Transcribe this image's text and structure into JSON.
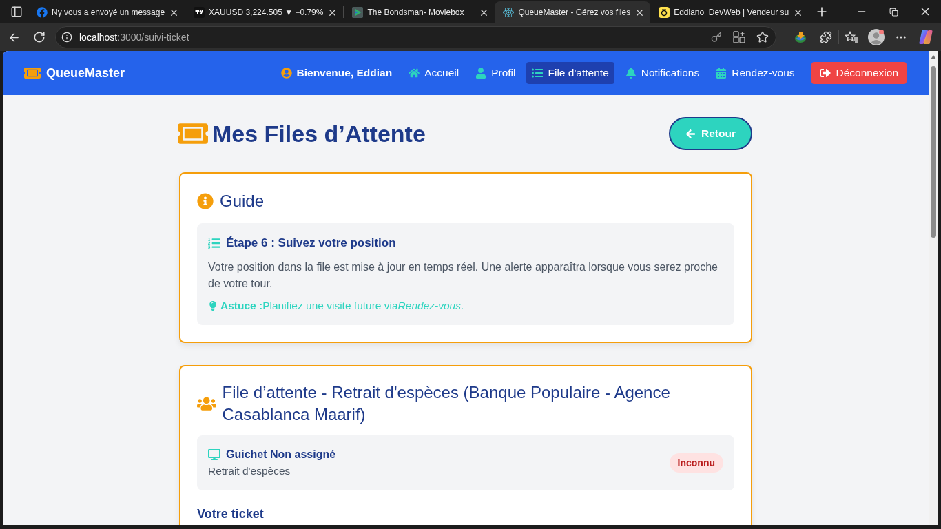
{
  "browser": {
    "tabs": [
      {
        "title": "Ny vous a envoyé un message",
        "selected": false
      },
      {
        "title": "XAUUSD 3,224.505 ▼ −0.79%",
        "selected": false
      },
      {
        "title": "The Bondsman- Moviebox",
        "selected": false
      },
      {
        "title": "QueueMaster - Gérez vos files",
        "selected": true
      },
      {
        "title": "Eddiano_DevWeb | Vendeur su",
        "selected": false
      }
    ],
    "address": {
      "host": "localhost",
      "path": ":3000/suivi-ticket"
    }
  },
  "nav": {
    "brand": "QueueMaster",
    "greeting": "Bienvenue, Eddian",
    "links": [
      {
        "label": "Accueil",
        "selected": false
      },
      {
        "label": "Profil",
        "selected": false
      },
      {
        "label": "File d'attente",
        "selected": true
      },
      {
        "label": "Notifications",
        "selected": false
      },
      {
        "label": "Rendez-vous",
        "selected": false
      }
    ],
    "logout": "Déconnexion"
  },
  "page": {
    "title": "Mes Files d’Attente",
    "back_button": "Retour"
  },
  "guide": {
    "title": "Guide",
    "step_title": "Étape 6 : Suivez votre position",
    "text": "Votre position dans la file est mise à jour en temps réel. Une alerte apparaîtra lorsque vous serez proche de votre tour.",
    "tip": {
      "label": "Astuce :",
      "text": "Planifiez une visite future via",
      "emphasis": "Rendez-vous",
      "end": "."
    }
  },
  "queues": [
    {
      "title": "File d’attente - Retrait d'espèces (Banque Populaire - Agence Casablanca Maarif)",
      "counter": "Guichet Non assigné",
      "service": "Retrait d'espèces",
      "status": "Inconnu",
      "ticket_heading": "Votre ticket"
    }
  ]
}
